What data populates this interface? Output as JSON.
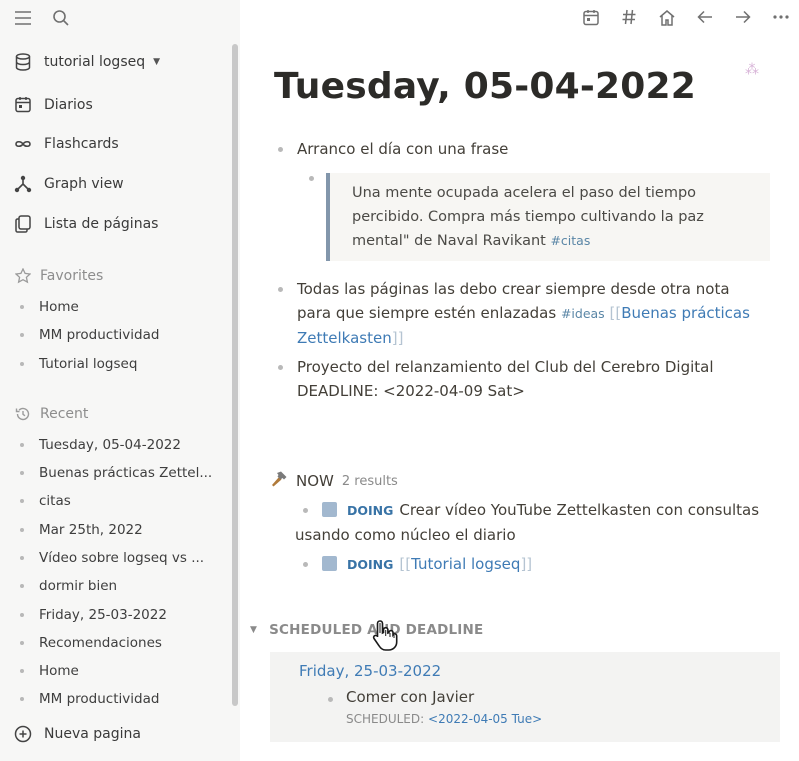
{
  "sidebar": {
    "graph_name": "tutorial logseq",
    "nav": [
      {
        "label": "Diarios",
        "icon": "calendar-icon"
      },
      {
        "label": "Flashcards",
        "icon": "infinity-icon"
      },
      {
        "label": "Graph view",
        "icon": "graph-icon"
      },
      {
        "label": "Lista de páginas",
        "icon": "pages-icon"
      }
    ],
    "favorites_title": "Favorites",
    "favorites": [
      "Home",
      "MM productividad",
      "Tutorial logseq"
    ],
    "recent_title": "Recent",
    "recent": [
      "Tuesday, 05-04-2022",
      "Buenas prácticas Zettel...",
      "citas",
      "Mar 25th, 2022",
      "Vídeo sobre logseq vs ...",
      "dormir bien",
      "Friday, 25-03-2022",
      "Recomendaciones",
      "Home",
      "MM productividad"
    ],
    "new_page": "Nueva pagina"
  },
  "page": {
    "title": "Tuesday, 05-04-2022",
    "block1": "Arranco el día con una frase",
    "quote_line1": "Una mente ocupada acelera el paso del tiempo",
    "quote_line2": "percibido. Compra más tiempo cultivando la paz",
    "quote_line3": "mental\" de Naval Ravikant",
    "quote_tag": "#citas",
    "block2_line1": "Todas las páginas las debo crear siempre desde otra nota",
    "block2_line2": "para que siempre estén enlazadas",
    "block2_tag": "#ideas",
    "block2_link_a": "Buenas prácticas",
    "block2_link_b": "Zettelkasten",
    "block3_line1": "Proyecto del relanzamiento del Club del Cerebro Digital",
    "block3_line2": "DEADLINE: <2022-04-09 Sat>",
    "bracket_open": "[[",
    "bracket_close": "]]"
  },
  "now": {
    "title": "NOW",
    "results": "2 results",
    "marker": "DOING",
    "item1_line1": "Crear vídeo YouTube Zettelkasten con consultas",
    "item1_line2": "usando como núcleo el diario",
    "item2_link": "Tutorial logseq"
  },
  "scheduled": {
    "title": "SCHEDULED AND DEADLINE",
    "date": "Friday, 25-03-2022",
    "item": "Comer con Javier",
    "meta_label": "SCHEDULED:",
    "meta_value": "<2022-04-05 Tue>"
  }
}
